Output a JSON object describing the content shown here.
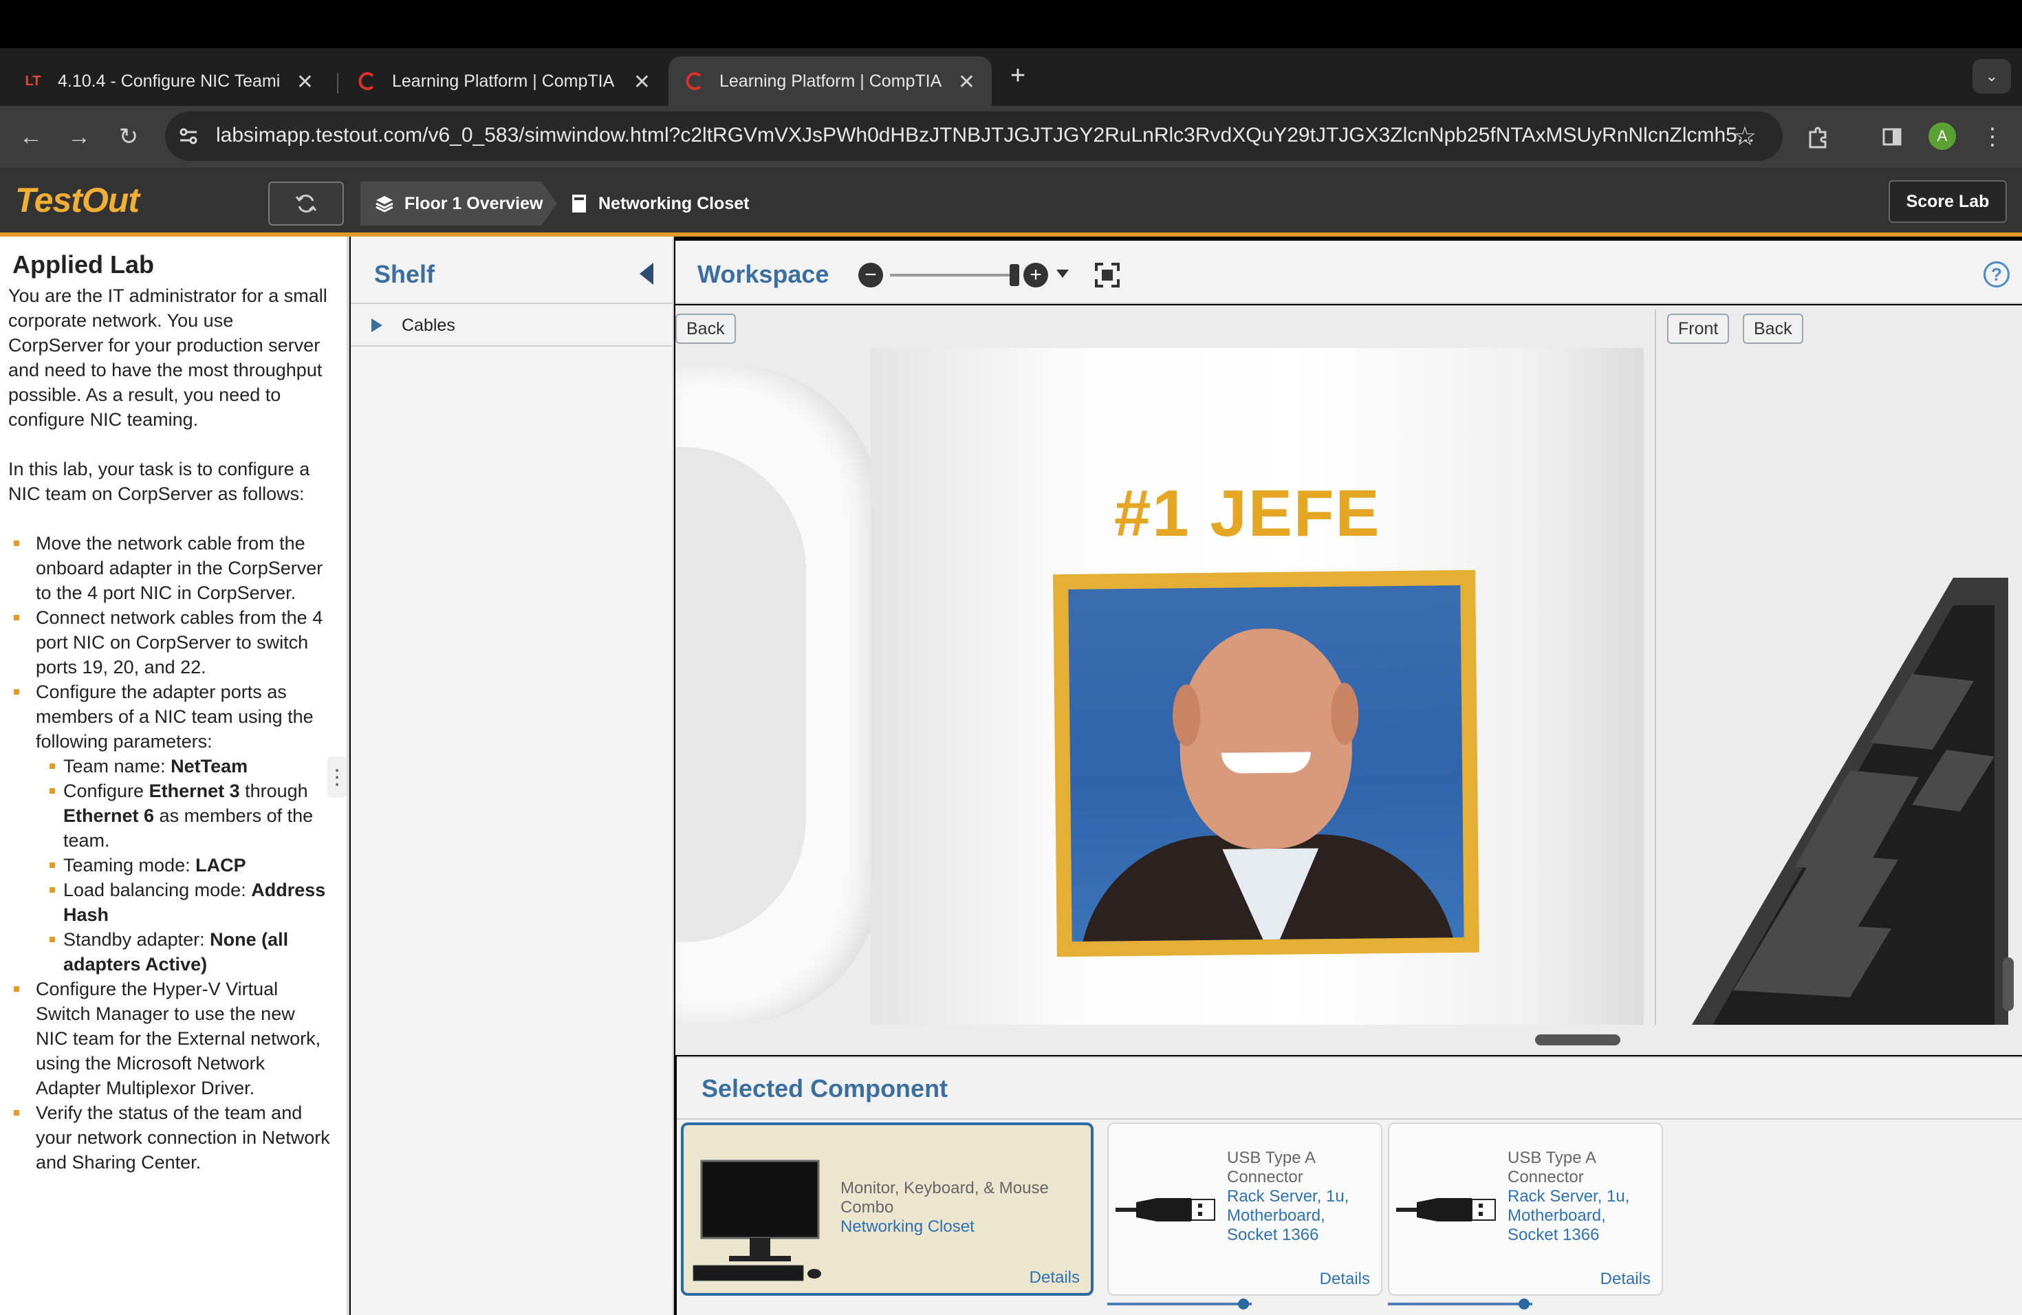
{
  "browser": {
    "tabs": [
      {
        "title": "4.10.4 - Configure NIC Teami",
        "favicon": "LT",
        "active": false
      },
      {
        "title": "Learning Platform | CompTIA",
        "favicon": "comptia-logo",
        "active": false
      },
      {
        "title": "Learning Platform | CompTIA",
        "favicon": "comptia-logo",
        "active": true
      }
    ],
    "url": "labsimapp.testout.com/v6_0_583/simwindow.html?c2ltRGVmVXJsPWh0dHBzJTNBJTJGJTJGY2RuLnRlc3RvdXQuY29tJTJGX3ZlcnNpb25fNTAxMSUyRnNlcnZlcmh5...",
    "profile_initial": "A"
  },
  "app": {
    "logo": "TestOut",
    "breadcrumb": [
      "Floor 1 Overview",
      "Networking Closet"
    ],
    "score_button": "Score Lab"
  },
  "lab": {
    "title": "Applied Lab",
    "intro": "You are the IT administrator for a small corporate network. You use CorpServer for your production server and need to have the most throughput possible. As a result, you need to configure NIC teaming.",
    "task_intro": "In this lab, your task is to configure a NIC team on CorpServer as follows:",
    "steps": [
      "Move the network cable from the onboard adapter in the CorpServer to the 4 port NIC in CorpServer.",
      "Connect network cables from the 4 port NIC on CorpServer to switch ports 19, 20, and 22.",
      "Configure the adapter ports as members of a NIC team using the following parameters:",
      "Configure the Hyper-V Virtual Switch Manager to use the new NIC team for the External network, using the Microsoft Network Adapter Multiplexor Driver.",
      "Verify the status of the team and your network connection in Network and Sharing Center."
    ],
    "params": {
      "team_name_label": "Team name: ",
      "team_name": "NetTeam",
      "configure_prefix": "Configure ",
      "eth_start": "Ethernet 3",
      "through": " through ",
      "eth_end": "Ethernet 6",
      "members_suffix": " as members of the team.",
      "teaming_label": "Teaming mode: ",
      "teaming": "LACP",
      "lb_label": "Load balancing mode: ",
      "lb": "Address Hash",
      "standby_label": "Standby adapter: ",
      "standby": "None (all adapters Active)"
    }
  },
  "shelf": {
    "title": "Shelf",
    "items": [
      "Cables"
    ]
  },
  "workspace": {
    "title": "Workspace",
    "left_view_button": "Back",
    "right_view_buttons": [
      "Front",
      "Back"
    ],
    "mug_text": "#1 JEFE"
  },
  "selected": {
    "title": "Selected Component",
    "cards": [
      {
        "type": "Monitor, Keyboard, & Mouse Combo",
        "location": "Networking Closet",
        "details": "Details",
        "selected": true
      },
      {
        "type": "USB Type A Connector",
        "location": "Rack Server, 1u, Motherboard, Socket 1366",
        "details": "Details",
        "selected": false
      },
      {
        "type": "USB Type A Connector",
        "location": "Rack Server, 1u, Motherboard, Socket 1366",
        "details": "Details",
        "selected": false
      }
    ]
  },
  "colors": {
    "accent_orange": "#e59a2a",
    "title_blue": "#3b6fa0",
    "link_blue": "#2f72b4"
  }
}
